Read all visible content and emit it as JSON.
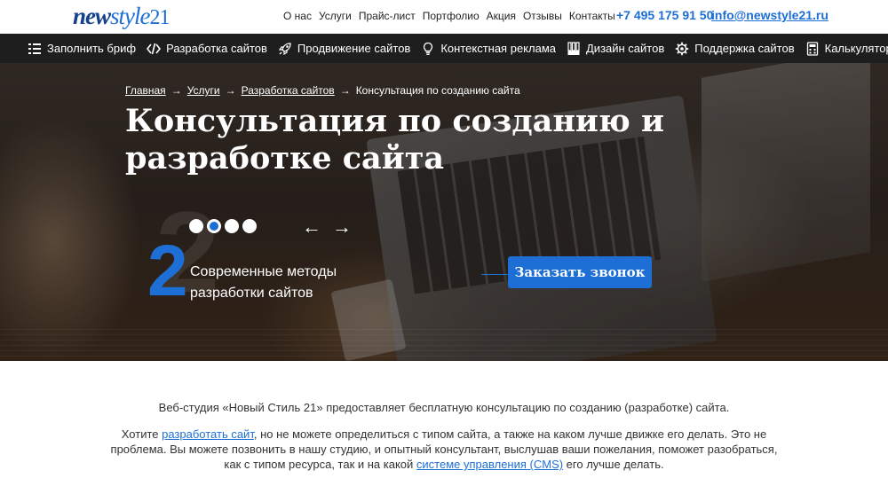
{
  "header": {
    "logo": {
      "part1": "new",
      "part2": "style",
      "part3": "21"
    },
    "top_links": [
      "О нас",
      "Услуги",
      "Прайс-лист",
      "Портфолио",
      "Акция",
      "Отзывы",
      "Контакты"
    ],
    "phone": "+7 495 175 91 50",
    "email": "info@newstyle21.ru"
  },
  "main_nav": [
    {
      "label": "Заполнить бриф",
      "icon": "brief-list-icon"
    },
    {
      "label": "Разработка сайтов",
      "icon": "code-icon"
    },
    {
      "label": "Продвижение сайтов",
      "icon": "rocket-icon"
    },
    {
      "label": "Контекстная реклама",
      "icon": "lightbulb-icon"
    },
    {
      "label": "Дизайн сайтов",
      "icon": "design-brushes-icon"
    },
    {
      "label": "Поддержка сайтов",
      "icon": "gear-icon"
    },
    {
      "label": "Калькулятор",
      "icon": "calculator-icon"
    }
  ],
  "hero": {
    "breadcrumbs": [
      "Главная",
      "Услуги",
      "Разработка сайтов",
      "Консультация по созданию сайта"
    ],
    "title": "Консультация по созданию и разработке сайта",
    "slide_number": "2",
    "slide_count": 4,
    "active_slide": 2,
    "prev_arrow": "←",
    "next_arrow": "→",
    "slide_text": "Современные методы разработки сайтов",
    "cta_label": "Заказать звонок"
  },
  "content": {
    "p1": "Веб-студия «Новый Стиль 21» предоставляет бесплатную консультацию по созданию (разработке) сайта.",
    "p2_pre": "Хотите ",
    "p2_link1": "разработать сайт",
    "p2_mid": ", но не можете определиться с типом сайта, а также на каком лучше движке его делать. Это не проблема. Вы можете позвонить в нашу студию, и опытный консультант, выслушав ваши пожелания, поможет разобраться, как с типом ресурса, так и на какой ",
    "p2_link2": "системе управления (CMS)",
    "p2_post": " его лучше делать."
  },
  "colors": {
    "accent": "#1d6fd6",
    "logo_dark": "#14418a",
    "nav_bg": "#1e1e1e"
  }
}
